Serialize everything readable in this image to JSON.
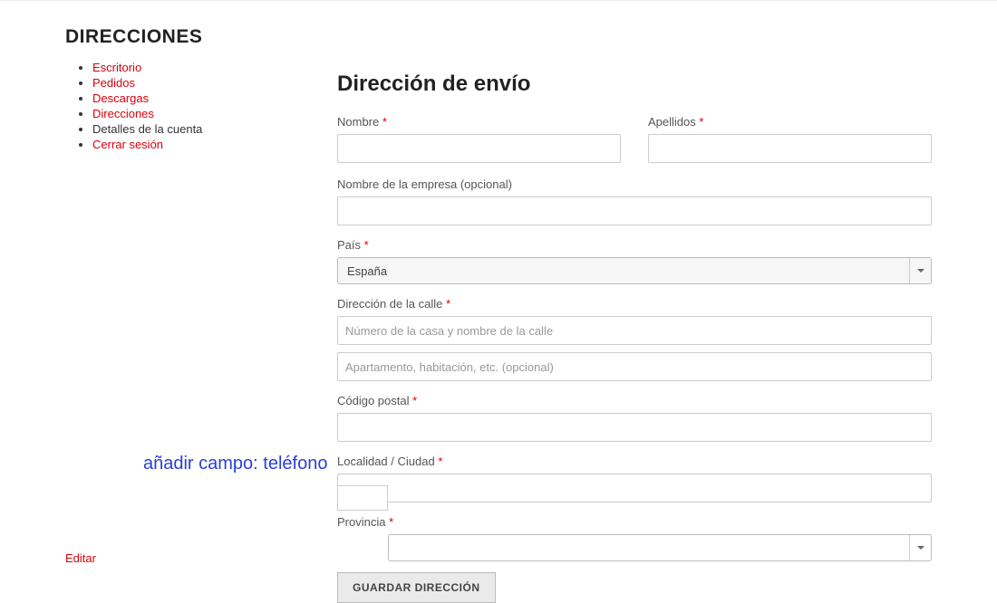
{
  "sidebar": {
    "title": "DIRECCIONES",
    "items": [
      {
        "label": "Escritorio",
        "link": true
      },
      {
        "label": "Pedidos",
        "link": true
      },
      {
        "label": "Descargas",
        "link": true
      },
      {
        "label": "Direcciones",
        "link": true
      },
      {
        "label": "Detalles de la cuenta",
        "link": false
      },
      {
        "label": "Cerrar sesión",
        "link": true
      }
    ]
  },
  "form": {
    "title": "Dirección de envío",
    "nombre_label": "Nombre",
    "apellidos_label": "Apellidos",
    "empresa_label": "Nombre de la empresa (opcional)",
    "pais_label": "País",
    "pais_value": "España",
    "calle_label": "Dirección de la calle",
    "calle_ph1": "Número de la casa y nombre de la calle",
    "calle_ph2": "Apartamento, habitación, etc. (opcional)",
    "cp_label": "Código postal",
    "localidad_label": "Localidad / Ciudad",
    "provincia_label": "Provincia",
    "submit": "GUARDAR DIRECCIÓN",
    "required_mark": "*"
  },
  "annotation": "añadir campo: teléfono",
  "edit_link": "Editar"
}
